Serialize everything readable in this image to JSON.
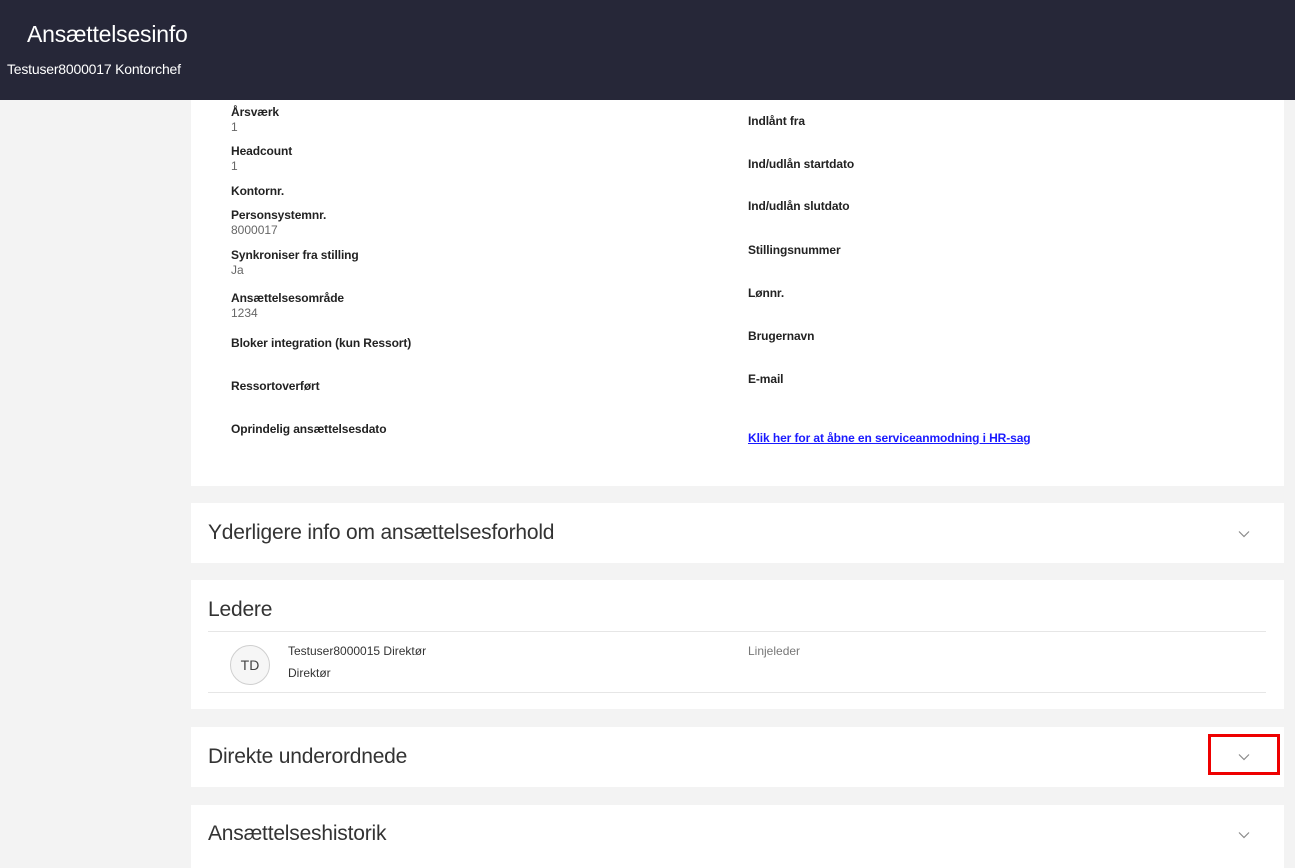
{
  "header": {
    "title": "Ansættelsesinfo",
    "subtitle": "Testuser8000017 Kontorchef"
  },
  "info": {
    "left": [
      {
        "label": "Årsværk",
        "value": "1"
      },
      {
        "label": "Headcount",
        "value": "1"
      },
      {
        "label": "Kontornr.",
        "value": ""
      },
      {
        "label": "Personsystemnr.",
        "value": "8000017"
      },
      {
        "label": "Synkroniser fra stilling",
        "value": "Ja"
      },
      {
        "label": "Ansættelsesområde",
        "value": "1234"
      },
      {
        "label": "Bloker integration (kun Ressort)",
        "value": ""
      },
      {
        "label": "Ressortoverført",
        "value": ""
      },
      {
        "label": "Oprindelig ansættelsesdato",
        "value": ""
      }
    ],
    "right": [
      {
        "label": "Indlånt fra",
        "value": ""
      },
      {
        "label": "Ind/udlån startdato",
        "value": ""
      },
      {
        "label": "Ind/udlån slutdato",
        "value": ""
      },
      {
        "label": "Stillingsnummer",
        "value": ""
      },
      {
        "label": "Lønnr.",
        "value": ""
      },
      {
        "label": "Brugernavn",
        "value": ""
      },
      {
        "label": "E-mail",
        "value": ""
      }
    ],
    "service_link": "Klik her for at åbne en serviceanmodning i HR-sag"
  },
  "sections": {
    "yderligere": "Yderligere info om ansættelsesforhold",
    "ledere": "Ledere",
    "direkte": "Direkte underordnede",
    "historik": "Ansættelseshistorik"
  },
  "manager": {
    "initials": "TD",
    "name": "Testuser8000015 Direktør",
    "role": "Direktør",
    "type": "Linjeleder"
  },
  "icons": {
    "expand": "chevron-down-icon"
  },
  "colors": {
    "header_bg": "#262738",
    "link": "#1a1aff",
    "highlight": "#ee0000"
  }
}
